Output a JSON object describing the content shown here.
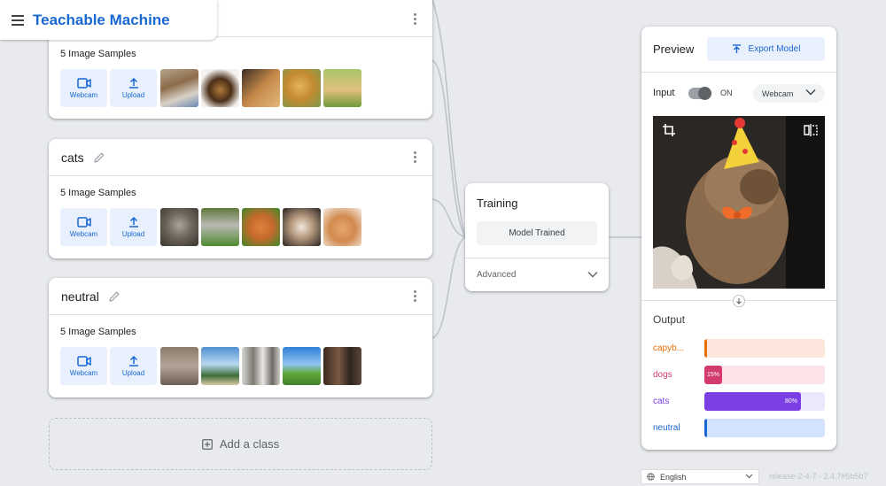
{
  "app": {
    "title": "Teachable Machine"
  },
  "classes": [
    {
      "name": "",
      "samples_label": "5 Image Samples",
      "webcam_label": "Webcam",
      "upload_label": "Upload"
    },
    {
      "name": "cats",
      "samples_label": "5 Image Samples",
      "webcam_label": "Webcam",
      "upload_label": "Upload"
    },
    {
      "name": "neutral",
      "samples_label": "5 Image Samples",
      "webcam_label": "Webcam",
      "upload_label": "Upload"
    }
  ],
  "add_class": {
    "label": "Add a class"
  },
  "training": {
    "title": "Training",
    "status_button": "Model Trained",
    "advanced_label": "Advanced"
  },
  "preview": {
    "title": "Preview",
    "export_label": "Export Model",
    "input_label": "Input",
    "toggle_state": "ON",
    "source_select": "Webcam",
    "output_label": "Output",
    "outputs": [
      {
        "label": "capyb...",
        "percent": 2,
        "value_text": "",
        "color": "#e8710a",
        "track": "#fde7dc"
      },
      {
        "label": "dogs",
        "percent": 15,
        "value_text": "15%",
        "color": "#d33b6e",
        "track": "#fce3e8"
      },
      {
        "label": "cats",
        "percent": 80,
        "value_text": "80%",
        "color": "#7b3fe4",
        "track": "#ede7fb"
      },
      {
        "label": "neutral",
        "percent": 2,
        "value_text": "",
        "color": "#1967d2",
        "track": "#d3e3fd"
      }
    ]
  },
  "footer": {
    "language": "English",
    "release": "release-2-4-7 - 2.4.7#5b5b7"
  },
  "colors": {
    "accent": "#1967d2",
    "background": "#e8eaed"
  }
}
